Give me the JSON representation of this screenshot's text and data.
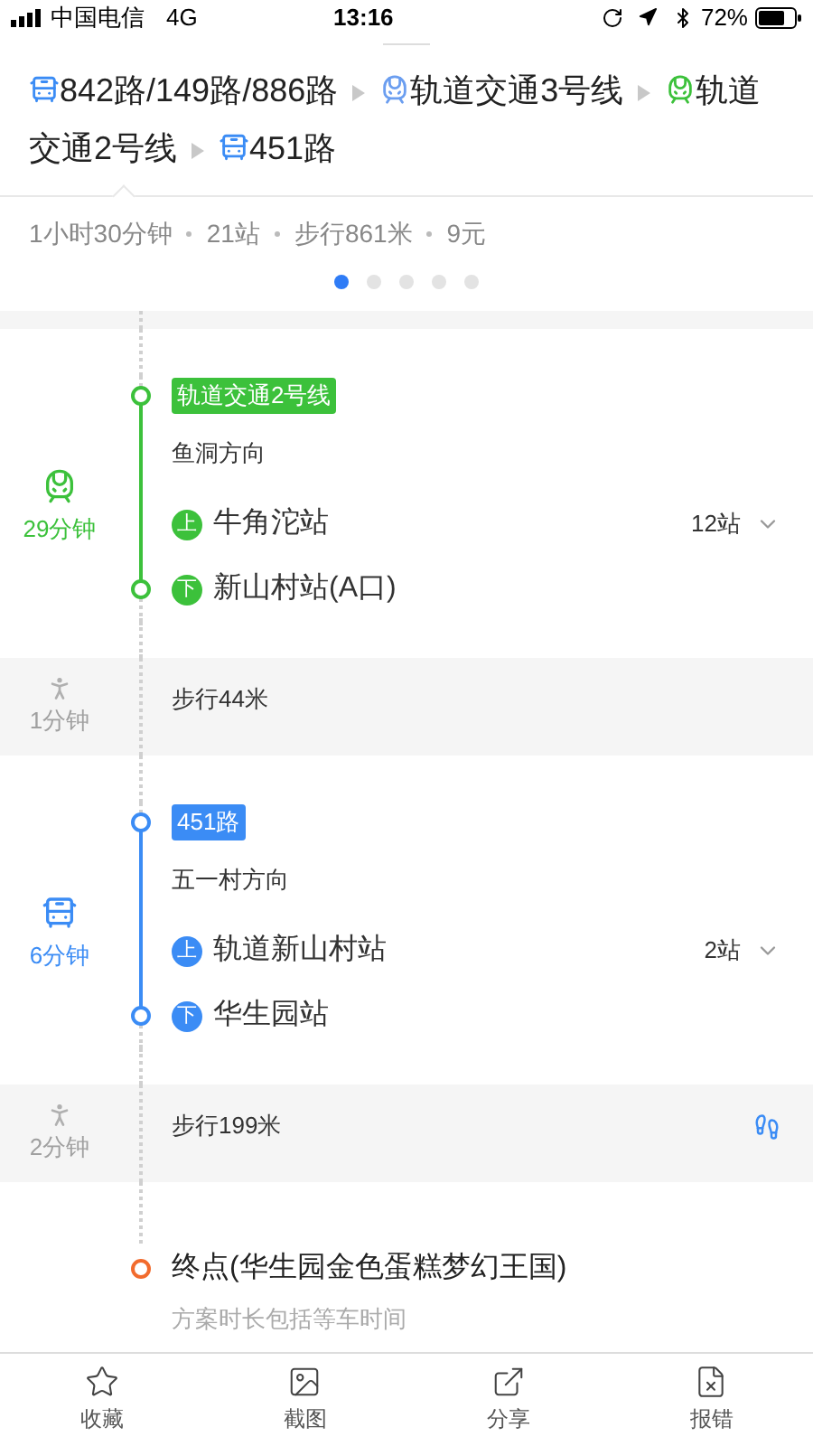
{
  "status_bar": {
    "carrier": "中国电信",
    "network": "4G",
    "time": "13:16",
    "battery": "72%"
  },
  "route": [
    {
      "kind": "bus",
      "color": "#3b8cf5",
      "name": "842路/149路/886路"
    },
    {
      "kind": "rail",
      "color": "#6b9ef0",
      "name": "轨道交通3号线"
    },
    {
      "kind": "rail",
      "color": "#3cc13b",
      "name": "轨道"
    },
    {
      "kind": "continued",
      "name": "交通2号线"
    },
    {
      "kind": "bus",
      "color": "#3b8cf5",
      "name": "451路"
    }
  ],
  "summary": [
    "1小时30分钟",
    "21站",
    "步行861米",
    "9元"
  ],
  "pages": [
    {
      "selected": true
    },
    {
      "selected": false
    },
    {
      "selected": false
    },
    {
      "selected": false
    },
    {
      "selected": false
    }
  ],
  "steps": [
    {
      "kind": "rail",
      "color": "#3cc13b",
      "duration": "29分钟",
      "line": "轨道交通2号线",
      "direction": "鱼洞方向",
      "board_badge": "上",
      "board": "牛角沱站",
      "stops": "12站",
      "alight_badge": "下",
      "alight": "新山村站(A口)"
    },
    {
      "kind": "walk",
      "duration": "1分钟",
      "text": "步行44米",
      "footprints": false
    },
    {
      "kind": "bus",
      "color": "#3b8cf5",
      "duration": "6分钟",
      "line": "451路",
      "direction": "五一村方向",
      "board_badge": "上",
      "board": "轨道新山村站",
      "stops": "2站",
      "alight_badge": "下",
      "alight": "华生园站"
    },
    {
      "kind": "walk",
      "duration": "2分钟",
      "text": "步行199米",
      "footprints": true
    },
    {
      "kind": "end",
      "text": "终点(华生园金色蛋糕梦幻王国)",
      "note": "方案时长包括等车时间"
    }
  ],
  "actions": [
    {
      "label": "收藏"
    },
    {
      "label": "截图"
    },
    {
      "label": "分享"
    },
    {
      "label": "报错"
    }
  ]
}
